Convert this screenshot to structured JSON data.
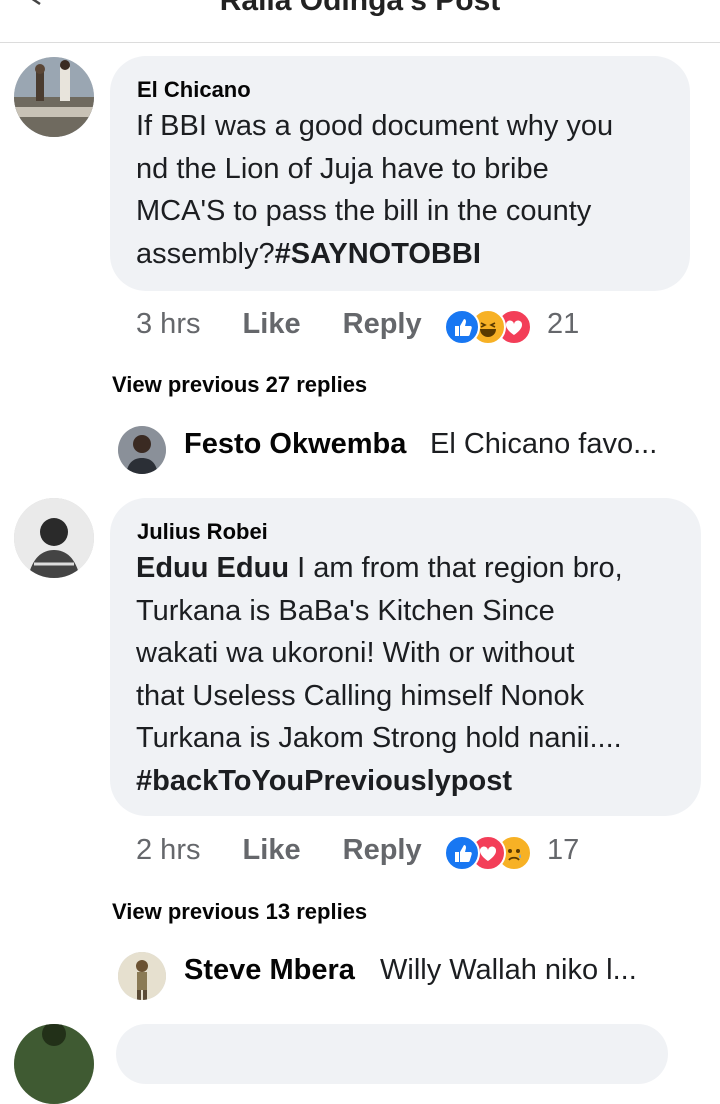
{
  "header": {
    "title": "Raila Odinga's Post"
  },
  "comments": [
    {
      "author": "El Chicano",
      "lines": [
        "If BBI was a good document why you",
        "nd the Lion of Juja have to bribe",
        "MCA'S to pass the bill in the county",
        "assembly?"
      ],
      "hashtag": "#SAYNOTOBBI",
      "time": "3 hrs",
      "like_label": "Like",
      "reply_label": "Reply",
      "reactions": [
        "like",
        "haha",
        "love"
      ],
      "reaction_count": "21",
      "view_previous": "View previous 27 replies",
      "reply_preview": {
        "name": "Festo Okwemba",
        "text": "El Chicano favo..."
      }
    },
    {
      "author": "Julius Robei",
      "mention": "Eduu Eduu",
      "lines": [
        "I am from that region bro,",
        "Turkana is BaBa's Kitchen Since",
        "wakati wa ukoroni! With or without",
        "that Useless Calling himself Nonok",
        "Turkana is Jakom Strong hold nanii...."
      ],
      "hashtag": "#backToYouPreviouslypost",
      "time": "2 hrs",
      "like_label": "Like",
      "reply_label": "Reply",
      "reactions": [
        "like",
        "love",
        "sad"
      ],
      "reaction_count": "17",
      "view_previous": "View previous 13 replies",
      "reply_preview": {
        "name": "Steve Mbera",
        "text": "Willy Wallah niko l..."
      }
    }
  ],
  "colors": {
    "bubble": "#f0f2f5",
    "meta_text": "#65676b",
    "like": "#1877f2",
    "love": "#f33e58",
    "haha": "#f7b125"
  }
}
